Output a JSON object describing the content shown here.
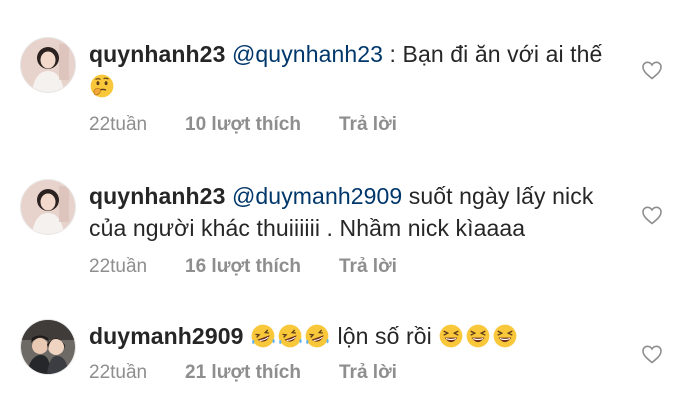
{
  "comments": [
    {
      "username": "quynhanh23",
      "mention": "@quynhanh23",
      "text_before_emoji": " : Bạn đi ăn với ai thế ",
      "emojis": [
        "thinking-face-emoji"
      ],
      "time": "22tuần",
      "likes": "10 lượt thích",
      "reply": "Trả lời"
    },
    {
      "username": "quynhanh23",
      "mention": "@duymanh2909",
      "text": " suốt ngày lấy nick của người khác thuiiiiii . Nhầm nick kìaaaa",
      "time": "22tuần",
      "likes": "16 lượt thích",
      "reply": "Trả lời"
    },
    {
      "username": "duymanh2909",
      "emojis_before": [
        "rofl-emoji",
        "rofl-emoji",
        "rofl-emoji"
      ],
      "text": " lộn số rồi ",
      "emojis_after": [
        "laughing-emoji",
        "laughing-emoji",
        "laughing-emoji"
      ],
      "time": "22tuần",
      "likes": "21 lượt thích",
      "reply": "Trả lời"
    }
  ],
  "colors": {
    "text": "#262626",
    "mention": "#00376b",
    "meta": "#8e8e8e",
    "emoji_face": "#f9c73a"
  }
}
